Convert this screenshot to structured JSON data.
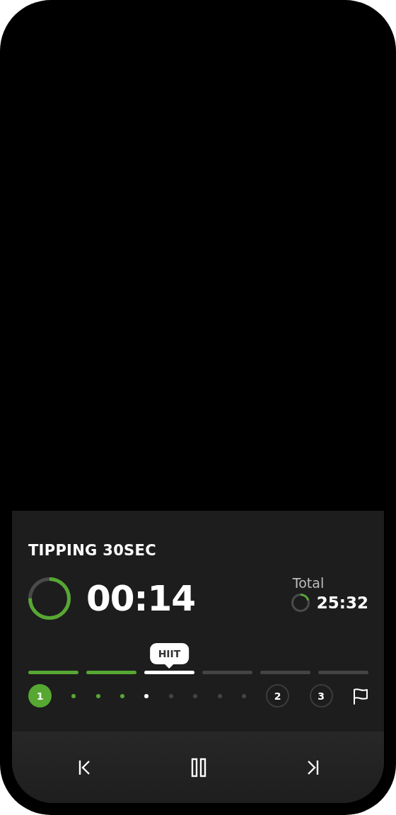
{
  "workout": {
    "title": "TIPPING 30SEC",
    "time": "00:14"
  },
  "total": {
    "label": "Total",
    "time": "25:32"
  },
  "segments": [
    {
      "done": true,
      "selected": false
    },
    {
      "done": true,
      "selected": false
    },
    {
      "selected": true,
      "tooltip": "HIIT"
    },
    {
      "done": false,
      "selected": false
    },
    {
      "done": false,
      "selected": false
    },
    {
      "done": false,
      "selected": false
    }
  ],
  "steps": [
    {
      "kind": "circle",
      "label": "1",
      "done": true
    },
    {
      "kind": "dot",
      "done": true,
      "selected": false
    },
    {
      "kind": "dot",
      "done": true,
      "selected": false
    },
    {
      "kind": "dot",
      "done": true,
      "selected": false
    },
    {
      "kind": "dot",
      "selected": true
    },
    {
      "kind": "dot",
      "done": false,
      "selected": false
    },
    {
      "kind": "dot",
      "done": false,
      "selected": false
    },
    {
      "kind": "dot",
      "done": false,
      "selected": false
    },
    {
      "kind": "dot",
      "done": false,
      "selected": false
    },
    {
      "kind": "circle",
      "label": "2",
      "done": false
    },
    {
      "kind": "circle",
      "label": "3",
      "done": false
    },
    {
      "kind": "flag"
    }
  ]
}
